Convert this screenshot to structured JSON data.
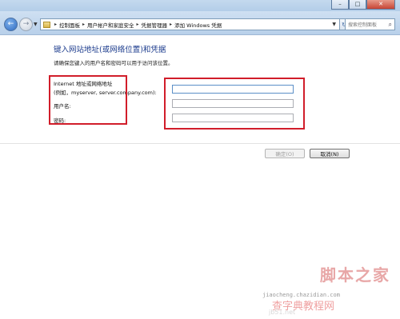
{
  "window": {
    "minimize_icon": "minimize-icon",
    "maximize_icon": "maximize-icon",
    "close_icon": "close-icon",
    "minimize_glyph": "–",
    "maximize_glyph": "□",
    "close_glyph": "✕"
  },
  "nav": {
    "back_icon": "back-arrow-icon",
    "forward_icon": "forward-arrow-icon",
    "back_glyph": "←",
    "forward_glyph": "→",
    "dropdown_glyph": "▼"
  },
  "breadcrumb": {
    "items": [
      "控制面板",
      "用户帐户和家庭安全",
      "凭据管理器",
      "添加 Windows 凭据"
    ],
    "separator": "▸"
  },
  "search": {
    "placeholder": "搜索控制面板",
    "icon": "search-icon"
  },
  "form": {
    "title": "键入网站地址(或网络位置)和凭据",
    "instruction": "请确保您键入的用户名和密码可以用于访问该位置。",
    "address_label": "Internet 地址或网络地址",
    "address_hint": "(例如，myserver, server.company.com):",
    "username_label": "用户名:",
    "password_label": "密码:",
    "address_value": "",
    "username_value": "",
    "password_value": ""
  },
  "buttons": {
    "ok": "确定(O)",
    "cancel": "取消(N)"
  },
  "watermark": {
    "domain_text": "jiaocheng.chazidian.com",
    "logo_main": "脚本之家",
    "logo_sub": "查字典教程网",
    "url": "jb51.net"
  },
  "colors": {
    "title_text": "#1a3a8c",
    "highlight_box": "#d11d2a",
    "watermark": "#e8a7a7"
  }
}
